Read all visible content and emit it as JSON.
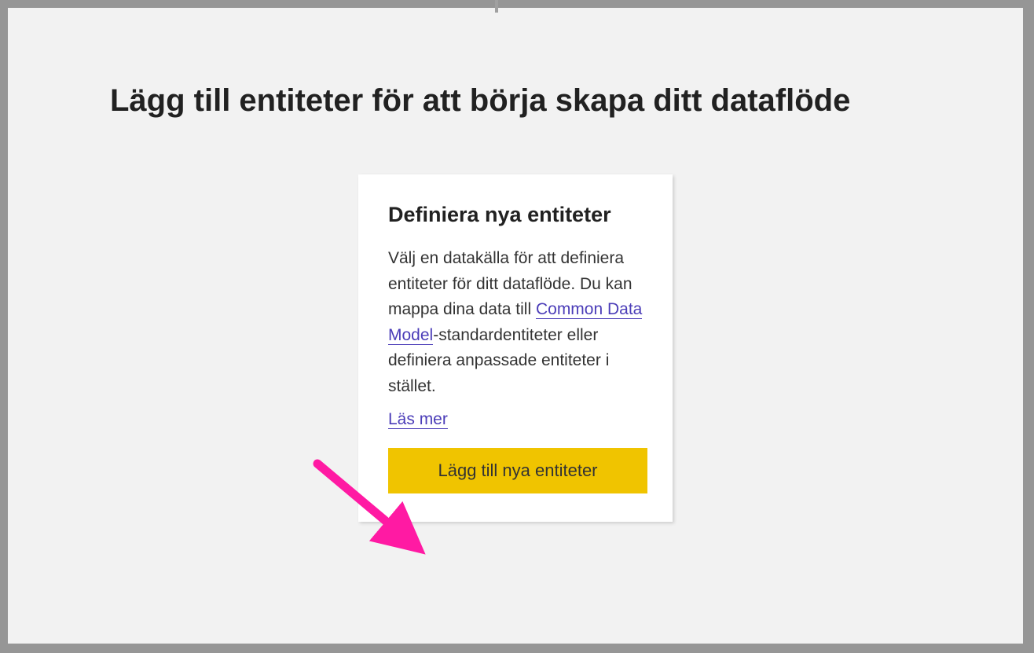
{
  "page": {
    "title": "Lägg till entiteter för att börja skapa ditt dataflöde"
  },
  "card": {
    "title": "Definiera nya entiteter",
    "body_prefix": "Välj en datakälla för att definiera entiteter för ditt dataflöde. Du kan mappa dina data till ",
    "link_text": "Common Data Model",
    "body_suffix": "-standardentiteter eller definiera anpassade entiteter i stället.",
    "learn_more": "Läs mer",
    "button_label": "Lägg till nya entiteter"
  },
  "colors": {
    "accent": "#f0c400",
    "link": "#4b3db8",
    "annotation": "#ff1aa3"
  }
}
